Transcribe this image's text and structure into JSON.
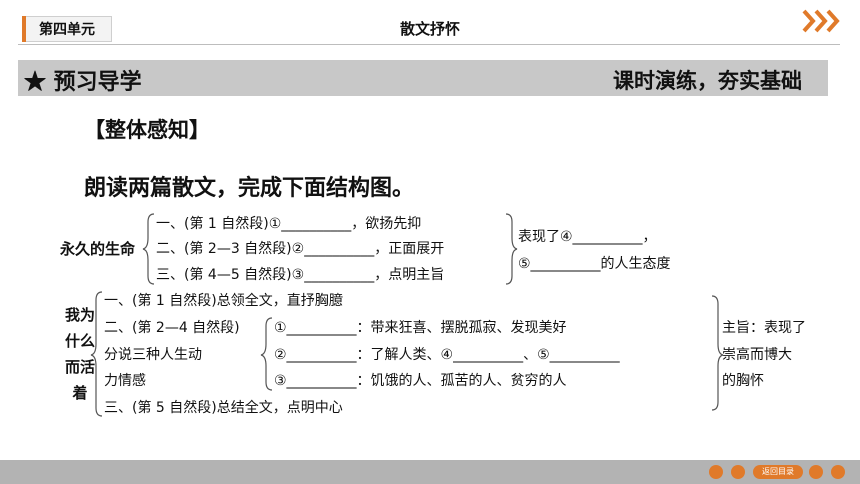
{
  "header": {
    "unit_tag": "第四单元",
    "title": "散文抒怀"
  },
  "banner": {
    "left": "★ 预习导学",
    "right": "课时演练，夯实基础"
  },
  "section_title": "【整体感知】",
  "instruction": "朗读两篇散文，完成下面结构图。",
  "diagram1": {
    "root": "永久的生命",
    "items": [
      "一、(第 1 自然段)①__________，欲扬先抑",
      "二、(第 2—3 自然段)②__________，正面展开",
      "三、(第 4—5 自然段)③__________，点明主旨"
    ],
    "result": [
      "表现了④__________，",
      "⑤__________的人生态度"
    ]
  },
  "diagram2": {
    "root": "我为什么而活着",
    "items": [
      "一、(第 1 自然段)总领全文，直抒胸臆",
      "二、(第 2—4 自然段)",
      "分说三种人生动",
      "力情感",
      "三、(第 5 自然段)总结全文，点明中心"
    ],
    "sub_items": [
      "①__________：带来狂喜、摆脱孤寂、发现美好",
      "②__________：了解人类、④__________、⑤__________",
      "③__________：饥饿的人、孤苦的人、贫穷的人"
    ],
    "summary": [
      "主旨：表现了",
      "崇高而博大",
      "的胸怀"
    ]
  },
  "footer": {
    "back_label": "返回目录"
  },
  "colors": {
    "accent": "#e07a2a",
    "banner": "#c8c8c8",
    "footer": "#b3b3b3"
  }
}
